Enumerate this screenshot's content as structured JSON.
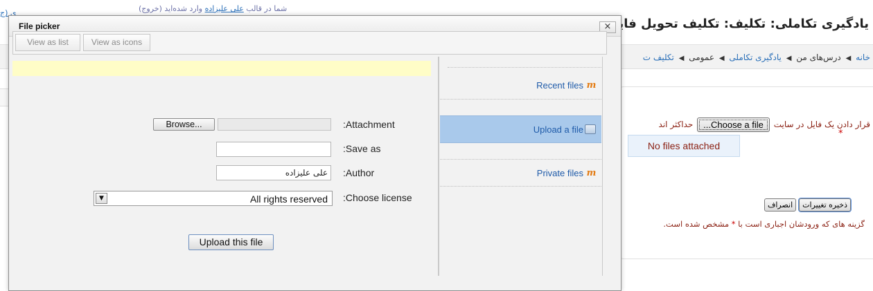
{
  "background_page": {
    "top_link": {
      "prefix": "شما در قالب ",
      "link": "علی علیزاده",
      "suffix": " وارد شده‌اید (خروج)"
    },
    "left_link": "ی (ج",
    "title": "یادگیری تکاملی: تکلیف: تکلیف تحویل فایل",
    "breadcrumb": [
      {
        "label": "خانه",
        "link": true
      },
      {
        "label": "درس‌های من",
        "link": false
      },
      {
        "label": "یادگیری تکاملی",
        "link": true
      },
      {
        "label": "عمومی",
        "link": false
      },
      {
        "label": "تکلیف ت",
        "link": true
      }
    ],
    "breadcrumb_separator": "◀",
    "upload": {
      "prefix": "قرار دادن یک فایل در سایت",
      "choose_button": "Choose a file...",
      "suffix": "حداکثر اند",
      "required_star": "*"
    },
    "no_files": "No files attached",
    "form_buttons": {
      "save": "ذخیره تغییرات",
      "cancel": "انصراف"
    },
    "required_note": {
      "prefix": "گزینه های که ورودشان اجباری است با",
      "star": "*",
      "suffix": "مشخص شده است."
    }
  },
  "file_picker": {
    "title": "File picker",
    "close_label": "×",
    "toolbar": {
      "view_list": "View as list",
      "view_icons": "View as icons"
    },
    "repositories": [
      {
        "label": "Recent files",
        "icon": "moodle-icon",
        "selected": false
      },
      {
        "label": "Upload a file",
        "icon": "upload-icon",
        "selected": true
      },
      {
        "label": "Private files",
        "icon": "moodle-icon",
        "selected": false
      }
    ],
    "form": {
      "attachment_label": ":Attachment",
      "browse_label": "Browse...",
      "save_as_label": ":Save as",
      "save_as_value": "",
      "author_label": ":Author",
      "author_value": "علی علیزاده",
      "license_label": ":Choose license",
      "license_value": "All rights reserved",
      "submit_label": "Upload this file"
    },
    "colors": {
      "selected_repo": "#a9c9eb",
      "message_bar": "#fffdc7",
      "link": "#1f5ba9",
      "error_text": "#8a1f11"
    }
  }
}
